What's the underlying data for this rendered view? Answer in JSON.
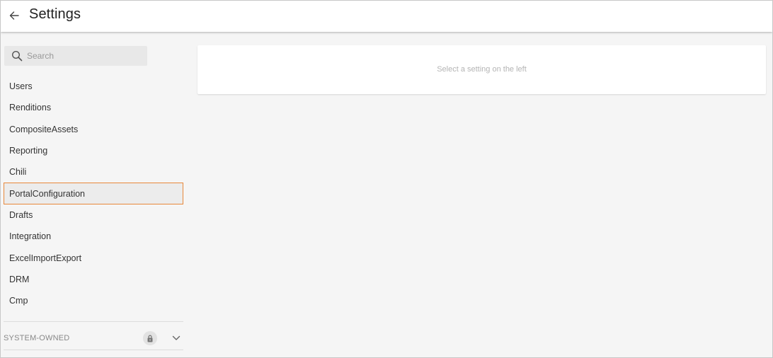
{
  "header": {
    "title": "Settings",
    "back_icon": "arrow-left-icon"
  },
  "sidebar": {
    "search": {
      "placeholder": "Search",
      "value": "",
      "icon": "search-icon"
    },
    "items": [
      {
        "label": "Users",
        "selected": false
      },
      {
        "label": "Renditions",
        "selected": false
      },
      {
        "label": "CompositeAssets",
        "selected": false
      },
      {
        "label": "Reporting",
        "selected": false
      },
      {
        "label": "Chili",
        "selected": false
      },
      {
        "label": "PortalConfiguration",
        "selected": true
      },
      {
        "label": "Drafts",
        "selected": false
      },
      {
        "label": "Integration",
        "selected": false
      },
      {
        "label": "ExcelImportExport",
        "selected": false
      },
      {
        "label": "DRM",
        "selected": false
      },
      {
        "label": "Cmp",
        "selected": false
      }
    ],
    "system_section": {
      "label": "SYSTEM-OWNED",
      "lock_icon": "lock-icon",
      "toggle_icon": "chevron-down-icon"
    }
  },
  "main": {
    "empty_message": "Select a setting on the left"
  },
  "colors": {
    "accent_border": "#e8883a",
    "background": "#f5f5f5",
    "card": "#ffffff"
  }
}
